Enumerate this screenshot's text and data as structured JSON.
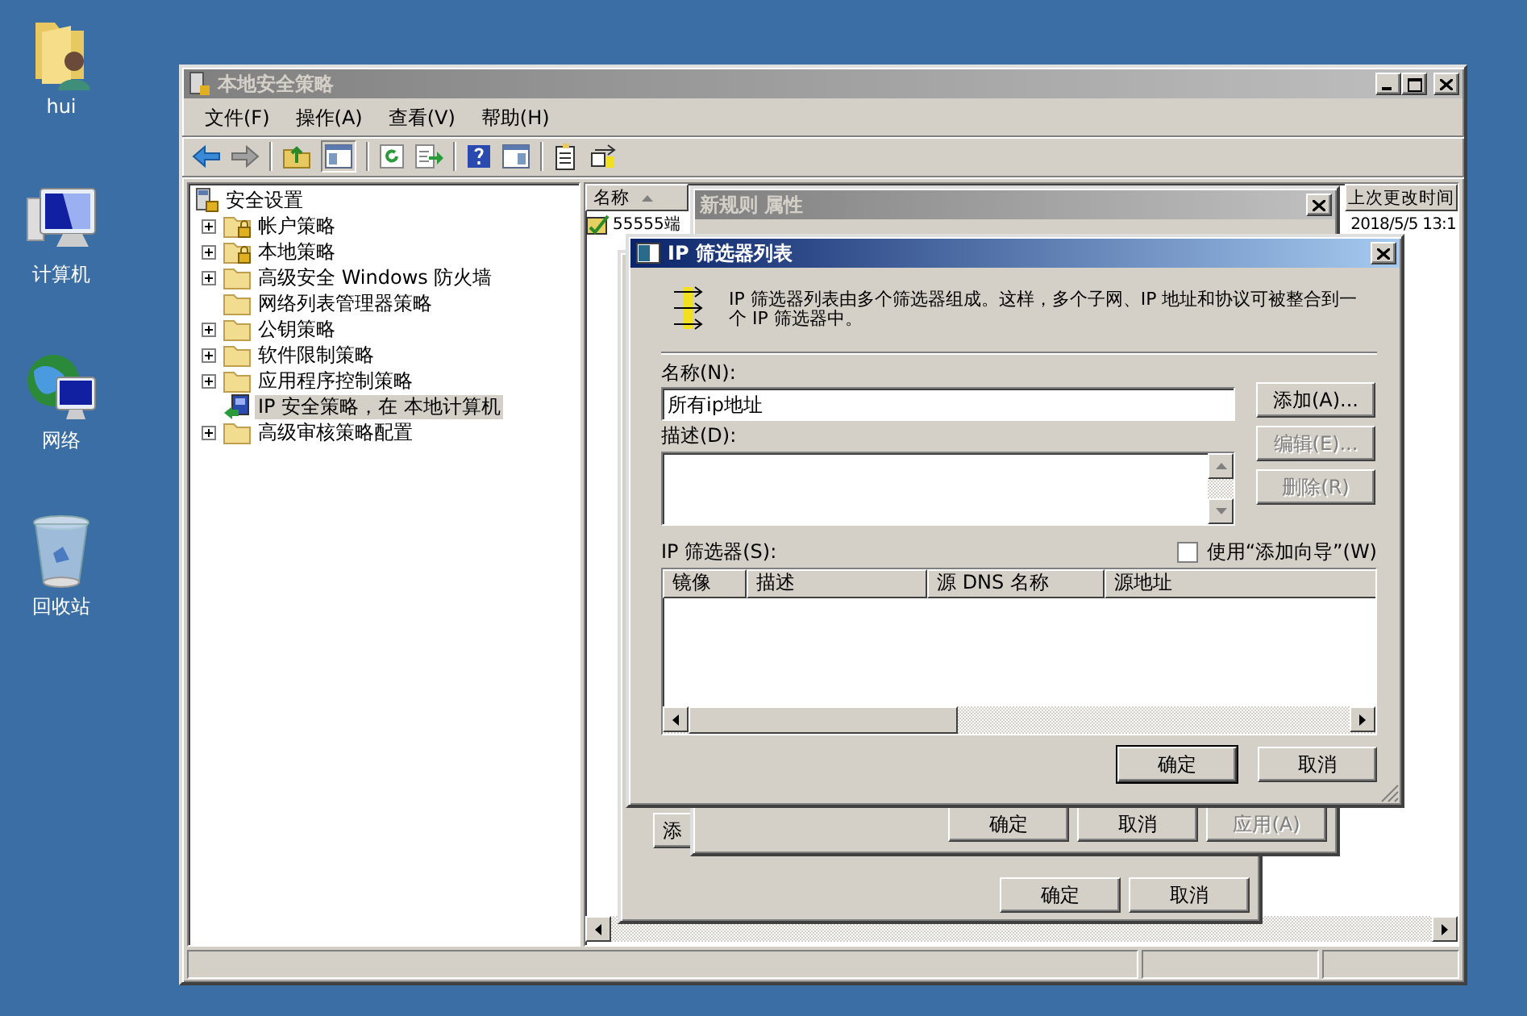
{
  "desktop_icons": [
    {
      "label": "hui",
      "kind": "user-folder"
    },
    {
      "label": "计算机",
      "kind": "computer"
    },
    {
      "label": "网络",
      "kind": "network"
    },
    {
      "label": "回收站",
      "kind": "recycle-bin"
    }
  ],
  "main_window": {
    "title": "本地安全策略",
    "menu": [
      "文件(F)",
      "操作(A)",
      "查看(V)",
      "帮助(H)"
    ],
    "tree": {
      "label": "安全设置",
      "children": [
        {
          "label": "帐户策略",
          "kind": "locked-folder",
          "expandable": true,
          "selected": false
        },
        {
          "label": "本地策略",
          "kind": "locked-folder",
          "expandable": true,
          "selected": false
        },
        {
          "label": "高级安全 Windows 防火墙",
          "kind": "folder",
          "expandable": true,
          "selected": false
        },
        {
          "label": "网络列表管理器策略",
          "kind": "folder",
          "expandable": false,
          "selected": false
        },
        {
          "label": "公钥策略",
          "kind": "folder",
          "expandable": true,
          "selected": false
        },
        {
          "label": "软件限制策略",
          "kind": "folder",
          "expandable": true,
          "selected": false
        },
        {
          "label": "应用程序控制策略",
          "kind": "folder",
          "expandable": true,
          "selected": false
        },
        {
          "label": "IP 安全策略，在 本地计算机",
          "kind": "ip-policy",
          "expandable": false,
          "selected": true
        },
        {
          "label": "高级审核策略配置",
          "kind": "folder",
          "expandable": true,
          "selected": false
        }
      ]
    },
    "list": {
      "columns": [
        {
          "label": "名称",
          "sorted": true
        },
        {
          "label": "上次更改时间",
          "sorted": false
        }
      ],
      "rows": [
        {
          "name": "55555端",
          "changed": "2018/5/5 13:1"
        }
      ]
    }
  },
  "back_dialog": {
    "side_button": "添",
    "buttons": [
      "确定",
      "取消"
    ]
  },
  "rule_dialog": {
    "title": "新规则 属性",
    "buttons": [
      {
        "label": "确定",
        "disabled": false
      },
      {
        "label": "取消",
        "disabled": false
      },
      {
        "label": "应用(A)",
        "disabled": true
      }
    ]
  },
  "filter_dialog": {
    "title": "IP 筛选器列表",
    "description": "IP 筛选器列表由多个筛选器组成。这样，多个子网、IP 地址和协议可被整合到一个 IP 筛选器中。",
    "name_label": "名称(N):",
    "name_value": "所有ip地址",
    "description_label": "描述(D):",
    "side_buttons": [
      {
        "label": "添加(A)...",
        "disabled": false
      },
      {
        "label": "编辑(E)...",
        "disabled": true
      },
      {
        "label": "删除(R)",
        "disabled": true
      }
    ],
    "filters_label": "IP 筛选器(S):",
    "wizard_checkbox": {
      "label": "使用“添加向导”(W)",
      "checked": false
    },
    "table": {
      "columns": [
        "镜像",
        "描述",
        "源 DNS 名称",
        "源地址"
      ]
    },
    "buttons": [
      {
        "label": "确定",
        "default": true
      },
      {
        "label": "取消",
        "default": false
      }
    ]
  }
}
